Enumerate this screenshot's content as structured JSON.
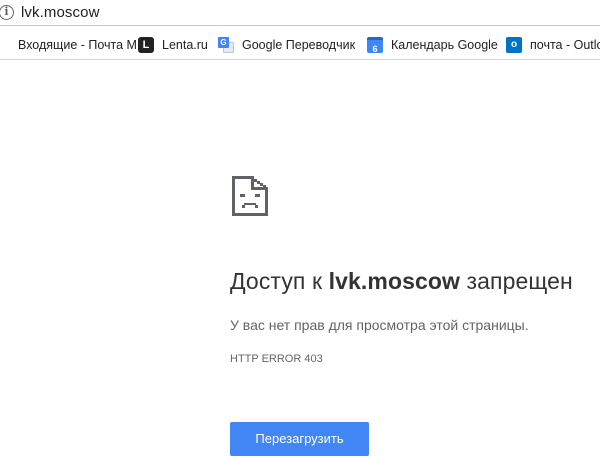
{
  "address_bar": {
    "url": "lvk.moscow",
    "info_icon_glyph": "i"
  },
  "bookmarks": [
    {
      "label": "Входящие - Почта М",
      "icon": "inbox-icon"
    },
    {
      "label": "Lenta.ru",
      "icon": "lenta-icon",
      "icon_glyph": "L"
    },
    {
      "label": "Google Переводчик",
      "icon": "google-translate-icon",
      "icon_glyph": "G"
    },
    {
      "label": "Календарь Google",
      "icon": "google-calendar-icon",
      "icon_glyph": "6"
    },
    {
      "label": "почта - Outlo",
      "icon": "outlook-icon",
      "icon_glyph": "o"
    }
  ],
  "error": {
    "icon": "sad-page-icon",
    "title_prefix": "Доступ к ",
    "title_host": "lvk.moscow",
    "title_suffix": " запрещен",
    "description": "У вас нет прав для просмотра этой страницы.",
    "code": "HTTP ERROR 403",
    "reload_label": "Перезагрузить"
  },
  "colors": {
    "button_blue": "#4285f4",
    "title_text": "#333333",
    "secondary_text": "#646464"
  }
}
